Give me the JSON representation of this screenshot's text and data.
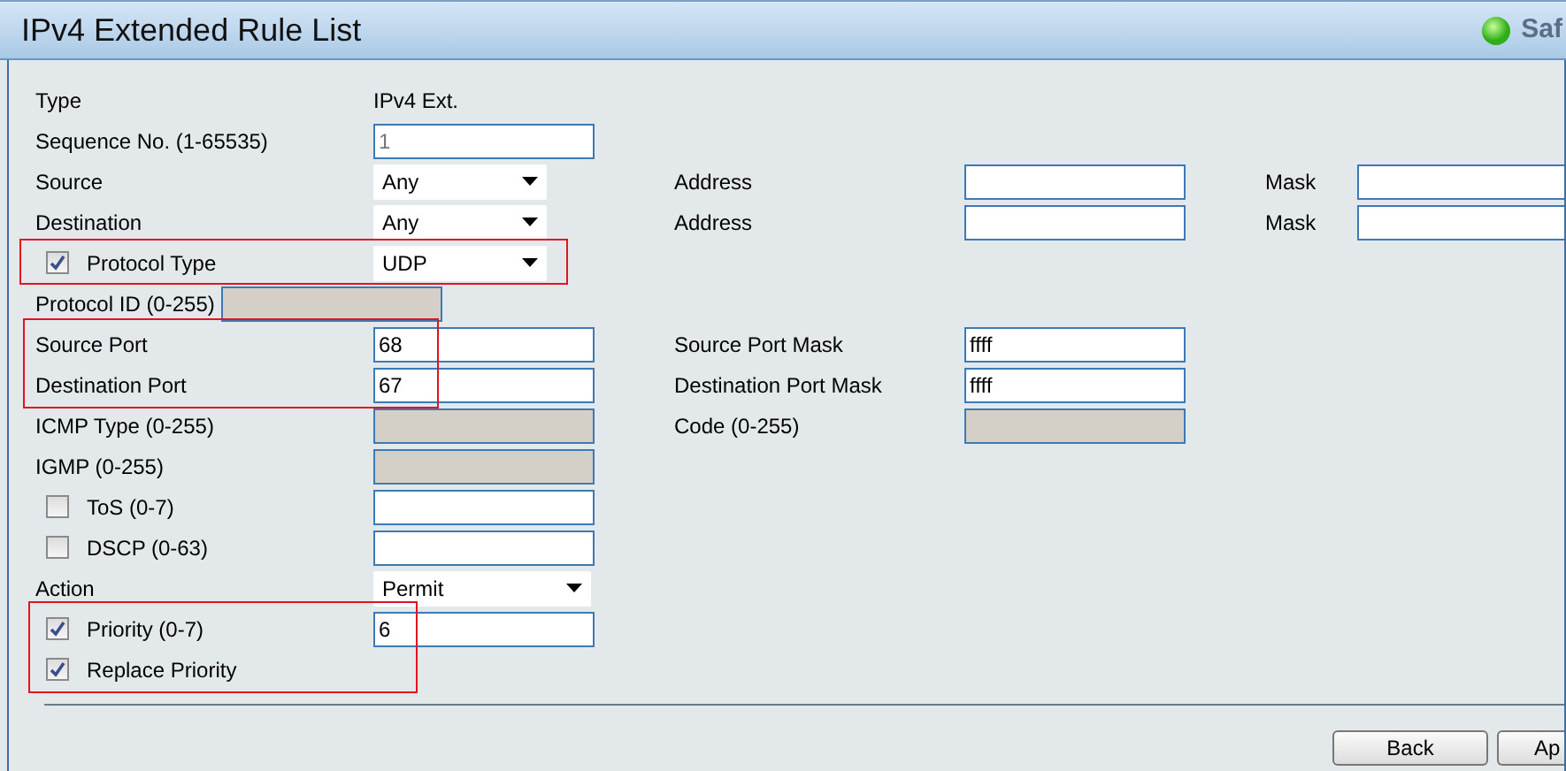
{
  "title": "IPv4 Extended Rule List",
  "status": {
    "text": "Saf"
  },
  "blocks": [
    {
      "highlighted": false,
      "rows": [
        {
          "kind": "normal",
          "label": "Type",
          "field": {
            "kind": "static",
            "value": "IPv4 Ext."
          }
        },
        {
          "kind": "normal",
          "label": "Sequence No. (1-65535)",
          "field": {
            "kind": "input",
            "placeholder": "1"
          }
        },
        {
          "kind": "normal",
          "label": "Source",
          "field": {
            "kind": "select",
            "value": "Any"
          },
          "label_2": "Address",
          "field_2": {
            "kind": "input"
          },
          "label_3": "Mask",
          "field_3": {
            "kind": "input"
          }
        },
        {
          "kind": "normal",
          "label": "Destination",
          "field": {
            "kind": "select",
            "value": "Any"
          },
          "label_2": "Address",
          "field_2": {
            "kind": "input"
          },
          "label_3": "Mask",
          "field_3": {
            "kind": "input"
          }
        }
      ]
    },
    {
      "highlighted": true,
      "rows": [
        {
          "kind": "normal",
          "label": "Protocol Type",
          "checked": true,
          "field": {
            "kind": "select",
            "value": "UDP"
          }
        }
      ]
    },
    {
      "highlighted": false,
      "rows": [
        {
          "kind": "inline",
          "label": "Protocol ID (0-255)",
          "field": {
            "kind": "disabled"
          }
        }
      ]
    },
    {
      "highlighted": true,
      "rows": [
        {
          "kind": "normal",
          "label": "Source Port",
          "field": {
            "kind": "input",
            "value": "68"
          },
          "label_2": "Source Port Mask",
          "field_2": {
            "kind": "input",
            "value": "ffff"
          }
        },
        {
          "kind": "normal",
          "label": "Destination Port",
          "field": {
            "kind": "input",
            "value": "67"
          },
          "label_2": "Destination Port Mask",
          "field_2": {
            "kind": "input",
            "value": "ffff"
          }
        }
      ]
    },
    {
      "highlighted": false,
      "rows": [
        {
          "kind": "normal",
          "label": "ICMP Type (0-255)",
          "field": {
            "kind": "disabled"
          },
          "label_2": "Code (0-255)",
          "field_2": {
            "kind": "disabled"
          }
        },
        {
          "kind": "normal",
          "label": "IGMP (0-255)",
          "field": {
            "kind": "disabled"
          }
        },
        {
          "kind": "normal",
          "label": "ToS  (0-7)",
          "checked": false,
          "field": {
            "kind": "input"
          }
        },
        {
          "kind": "normal",
          "label": "DSCP  (0-63)",
          "checked": false,
          "field": {
            "kind": "input"
          }
        },
        {
          "kind": "normal",
          "label": "Action",
          "field": {
            "kind": "wide-select",
            "value": "Permit"
          }
        }
      ]
    },
    {
      "highlighted": true,
      "rows": [
        {
          "kind": "normal",
          "label": "Priority  (0-7)",
          "checked": true,
          "field": {
            "kind": "input",
            "value": "6"
          }
        },
        {
          "kind": "normal",
          "label": "Replace Priority",
          "checked": true
        }
      ]
    }
  ],
  "buttons": [
    {
      "label": "Back",
      "cut": false
    },
    {
      "label": "Ap",
      "cut": true
    }
  ]
}
